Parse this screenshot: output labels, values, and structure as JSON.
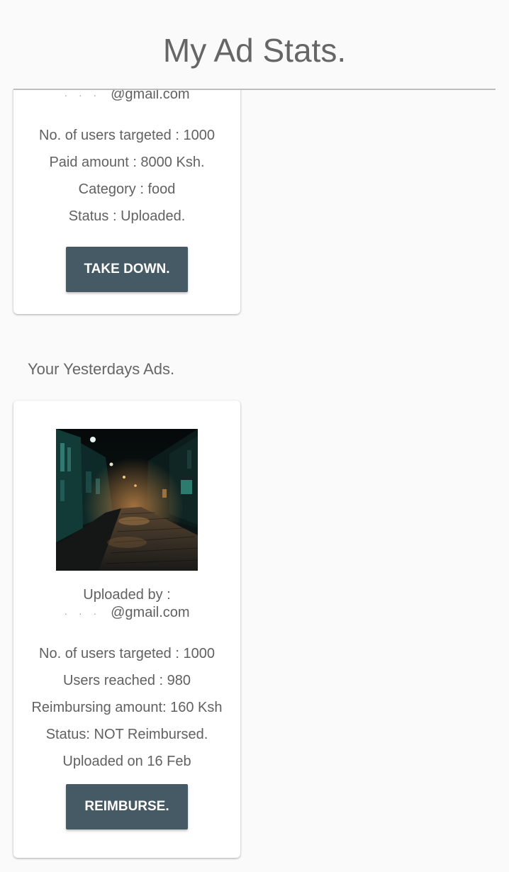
{
  "header": {
    "title": "My Ad Stats."
  },
  "current_ad": {
    "uploader_email_visible": "@gmail.com",
    "users_targeted": "No. of users targeted : 1000",
    "paid_amount": "Paid amount : 8000 Ksh.",
    "category": "Category : food",
    "status": "Status : Uploaded.",
    "action_label": "TAKE DOWN."
  },
  "yesterday_section": {
    "heading": "Your Yesterdays Ads."
  },
  "yesterday_ad": {
    "image_icon": "night-street-photo",
    "uploaded_by_label": "Uploaded by :",
    "uploader_email_visible": "@gmail.com",
    "users_targeted": "No. of users targeted : 1000",
    "users_reached": "Users reached : 980",
    "reimbursing_amount": "Reimbursing amount: 160 Ksh",
    "status": "Status: NOT Reimbursed.",
    "uploaded_on": "Uploaded on 16 Feb",
    "action_label": "REIMBURSE."
  },
  "colors": {
    "background": "#fafafa",
    "card": "#ffffff",
    "button": "#455a64",
    "button_text": "#ffffff",
    "text": "#616161",
    "divider": "#bdbdbd"
  }
}
